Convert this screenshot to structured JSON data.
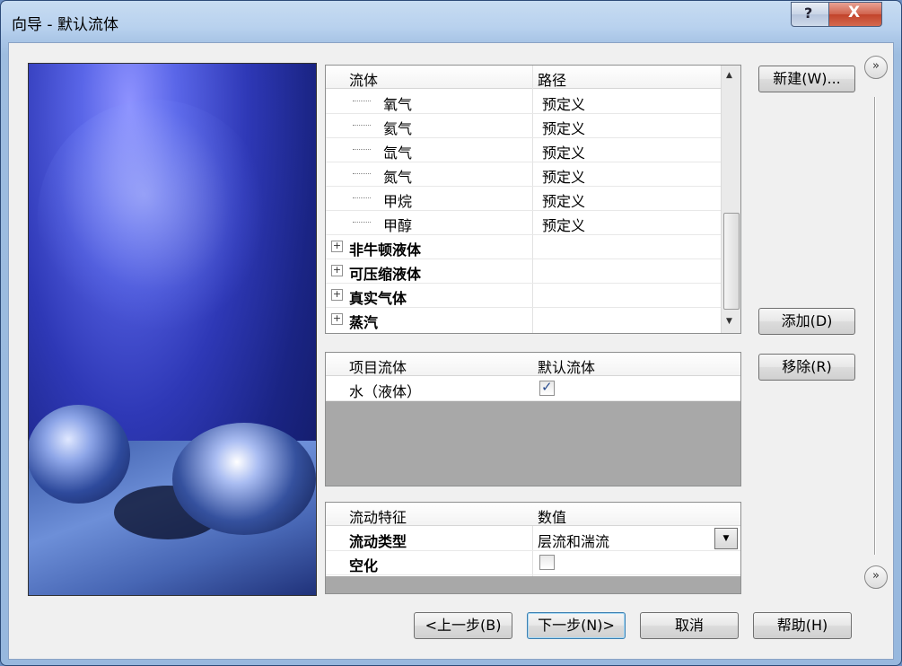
{
  "window": {
    "title": "向导 - 默认流体",
    "help_glyph": "?",
    "close_glyph": "X"
  },
  "fluids_table": {
    "headers": [
      "流体",
      "路径"
    ],
    "child_rows": [
      {
        "name": "氧气",
        "path": "预定义"
      },
      {
        "name": "氦气",
        "path": "预定义"
      },
      {
        "name": "氙气",
        "path": "预定义"
      },
      {
        "name": "氮气",
        "path": "预定义"
      },
      {
        "name": "甲烷",
        "path": "预定义"
      },
      {
        "name": "甲醇",
        "path": "预定义"
      }
    ],
    "groups": [
      "非牛顿液体",
      "可压缩液体",
      "真实气体",
      "蒸汽"
    ],
    "expand_glyph": "+"
  },
  "project_fluids": {
    "headers": [
      "项目流体",
      "默认流体"
    ],
    "rows": [
      {
        "name": "水（液体）",
        "default": true
      }
    ]
  },
  "flow_props": {
    "headers": [
      "流动特征",
      "数值"
    ],
    "rows": [
      {
        "name": "流动类型",
        "value": "层流和湍流"
      },
      {
        "name": "空化",
        "value": ""
      }
    ],
    "cavitation_checked": false
  },
  "side_buttons": {
    "new": "新建(W)...",
    "add": "添加(D)",
    "remove": "移除(R)"
  },
  "bottom_buttons": {
    "back": "<上一步(B)",
    "next": "下一步(N)>",
    "cancel": "取消",
    "help": "帮助(H)"
  },
  "expand_glyph": "»"
}
